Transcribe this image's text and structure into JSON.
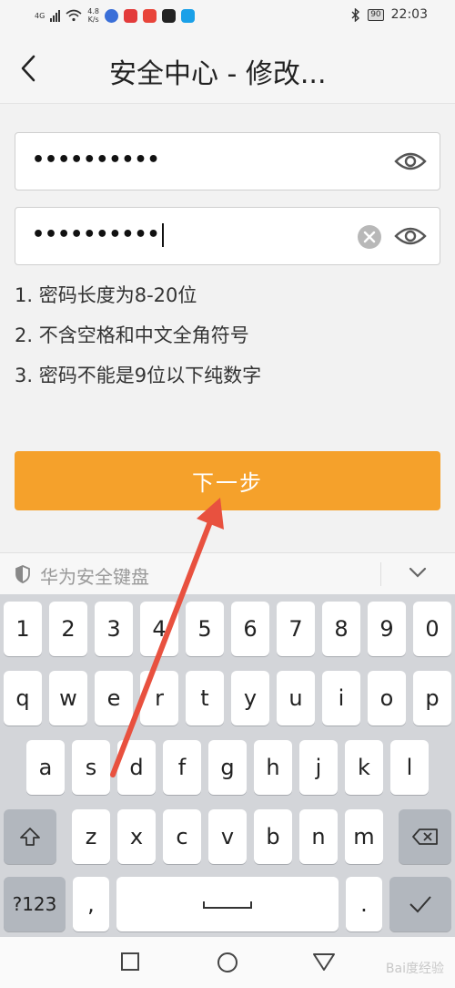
{
  "status_bar": {
    "network_type": "4G",
    "net_speed": "4.8",
    "net_speed_unit": "K/s",
    "battery": "90",
    "time": "22:03",
    "app_icon_colors": [
      "#3a6fd8",
      "#e33b3b",
      "#e8443a",
      "#222222",
      "#1aa0e8"
    ]
  },
  "header": {
    "back_icon": "chevron-left-icon",
    "title": "安全中心 - 修改..."
  },
  "form": {
    "password_value": "••••••••••",
    "confirm_value": "••••••••••",
    "eye_icon": "eye-icon",
    "clear_icon": "clear-icon"
  },
  "rules": [
    "1. 密码长度为8-20位",
    "2. 不含空格和中文全角符号",
    "3. 密码不能是9位以下纯数字"
  ],
  "next_button": {
    "label": "下一步",
    "color": "#f5a12b"
  },
  "keyboard": {
    "title": "华为安全键盘",
    "row_numbers": [
      "1",
      "2",
      "3",
      "4",
      "5",
      "6",
      "7",
      "8",
      "9",
      "0"
    ],
    "row_top": [
      "q",
      "w",
      "e",
      "r",
      "t",
      "y",
      "u",
      "i",
      "o",
      "p"
    ],
    "row_middle": [
      "a",
      "s",
      "d",
      "f",
      "g",
      "h",
      "j",
      "k",
      "l"
    ],
    "row_bottom": [
      "z",
      "x",
      "c",
      "v",
      "b",
      "n",
      "m"
    ],
    "symbols_key": "?123",
    "comma_key": ",",
    "period_key": "."
  },
  "navigation": {
    "back": "triangle-back-icon",
    "home": "circle-home-icon",
    "recent": "square-recent-icon"
  },
  "watermark": "Bai度经验",
  "annotation_color": "#e8513f"
}
